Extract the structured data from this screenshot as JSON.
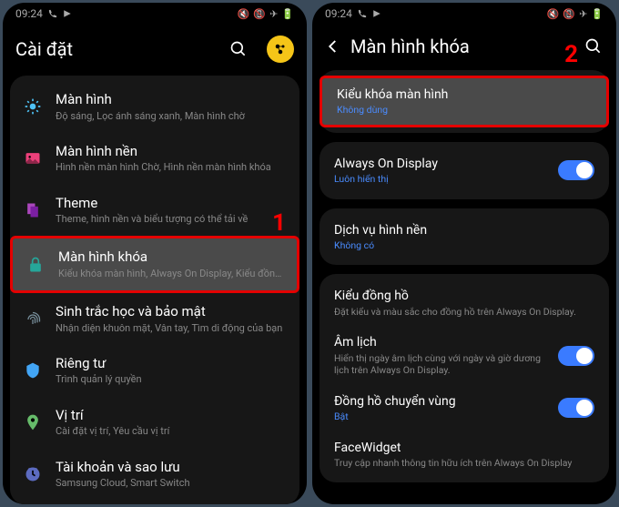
{
  "statusbar": {
    "time": "09:24",
    "icons_right": "✕ ✈ ⚡"
  },
  "panel1": {
    "header_title": "Cài đặt",
    "annot": "1",
    "rows": [
      {
        "icon": "brightness",
        "title": "Màn hình",
        "sub": "Độ sáng, Lọc ánh sáng xanh, Màn hình chờ"
      },
      {
        "icon": "wallpaper",
        "title": "Màn hình nền",
        "sub": "Hình nền màn hình Chờ, Hình nền màn hình khóa"
      },
      {
        "icon": "theme",
        "title": "Theme",
        "sub": "Theme, hình nền và biểu tượng có thể tải về"
      },
      {
        "icon": "lock",
        "title": "Màn hình khóa",
        "sub": "Kiểu khóa màn hình, Always On Display, Kiểu đồng hồ",
        "highlight": true
      },
      {
        "icon": "fingerprint",
        "title": "Sinh trắc học và bảo mật",
        "sub": "Nhận diện khuôn mặt, Vân tay, Tìm di động của bạn"
      },
      {
        "icon": "privacy",
        "title": "Riêng tư",
        "sub": "Trình quản lý quyền"
      },
      {
        "icon": "location",
        "title": "Vị trí",
        "sub": "Cài đặt vị trí, Yêu cầu vị trí"
      },
      {
        "icon": "backup",
        "title": "Tài khoản và sao lưu",
        "sub": "Samsung Cloud, Smart Switch"
      }
    ]
  },
  "panel2": {
    "header_title": "Màn hình khóa",
    "annot": "2",
    "groups": [
      [
        {
          "title": "Kiểu khóa màn hình",
          "sub": "Không dùng",
          "sub_blue": true,
          "highlight": true
        }
      ],
      [
        {
          "title": "Always On Display",
          "sub": "Luôn hiển thị",
          "sub_blue": true,
          "toggle": true
        }
      ],
      [
        {
          "title": "Dịch vụ hình nền",
          "sub": "Không có",
          "sub_blue": true
        }
      ],
      [
        {
          "title": "Kiểu đồng hồ",
          "sub": "Đặt kiểu và màu sắc cho đồng hồ trên Always On Display."
        },
        {
          "title": "Âm lịch",
          "sub": "Hiển thị ngày âm lịch cùng với ngày và giờ dương lịch trên Always On Display.",
          "toggle": true
        },
        {
          "title": "Đồng hồ chuyển vùng",
          "sub": "Bật",
          "sub_blue": true,
          "toggle": true
        },
        {
          "title": "FaceWidget",
          "sub": "Truy cập nhanh thông tin hữu ích trên Always On Display"
        }
      ]
    ]
  }
}
